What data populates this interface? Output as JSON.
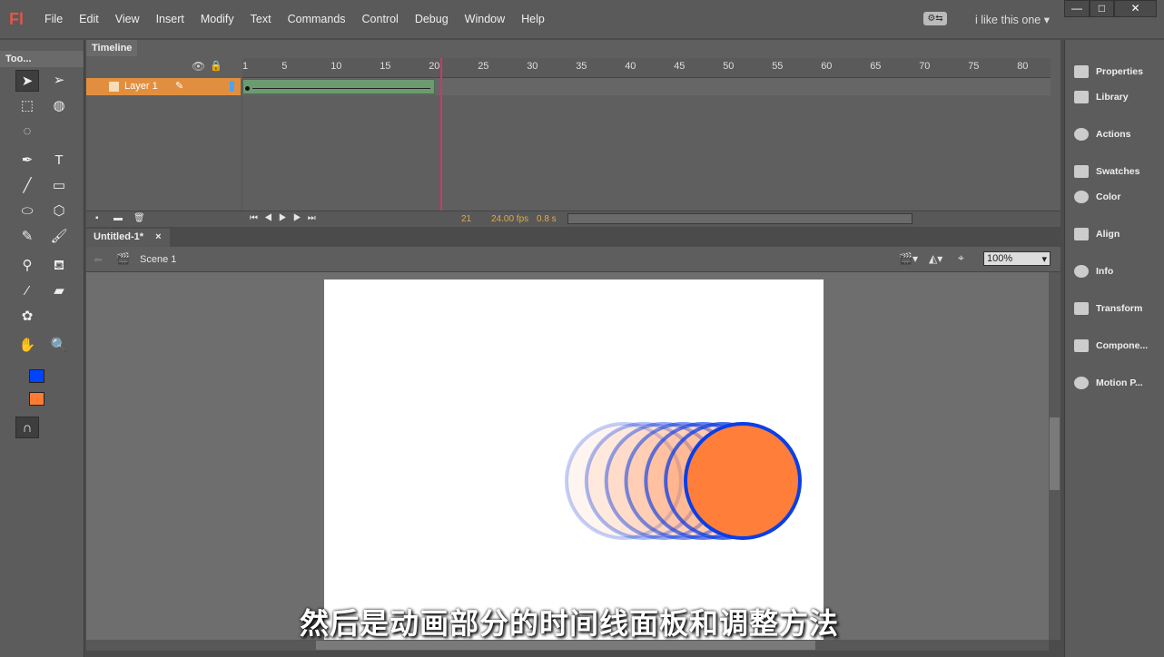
{
  "app": {
    "logo": "Fl",
    "menus": [
      "File",
      "Edit",
      "View",
      "Insert",
      "Modify",
      "Text",
      "Commands",
      "Control",
      "Debug",
      "Window",
      "Help"
    ],
    "workspace": "i like this one",
    "window_buttons": [
      "—",
      "□",
      "✕"
    ]
  },
  "tools": {
    "header": "Too...",
    "swatches": {
      "stroke": "#0044ff",
      "fill": "#ff7b33"
    }
  },
  "timeline": {
    "title": "Timeline",
    "ticks": [
      "1",
      "5",
      "10",
      "15",
      "20",
      "25",
      "30",
      "35",
      "40",
      "45",
      "50",
      "55",
      "60",
      "65",
      "70",
      "75",
      "80"
    ],
    "layer": "Layer 1",
    "current_frame": "21",
    "fps": "24.00 fps",
    "time": "0.8 s",
    "tween_color": "#6c9b72",
    "layer_color": "#e18f3f"
  },
  "document": {
    "tab": "Untitled-1*",
    "close": "×",
    "scene": "Scene 1",
    "zoom": "100%"
  },
  "stage": {
    "circle_fill": "#ff7f3a",
    "circle_stroke": "#0a3ee8"
  },
  "subtitle": "然后是动画部分的时间线面板和调整方法",
  "panels": [
    "Properties",
    "Library",
    "Actions",
    "Swatches",
    "Color",
    "Align",
    "Info",
    "Transform",
    "Compone...",
    "Motion P..."
  ]
}
